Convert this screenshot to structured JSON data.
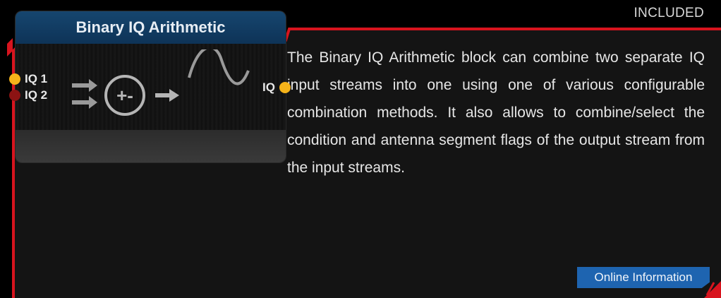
{
  "status_badge": "INCLUDED",
  "block": {
    "title": "Binary IQ Arithmetic",
    "input_ports": [
      {
        "label": "IQ 1",
        "color": "#f5b31a"
      },
      {
        "label": "IQ 2",
        "color": "#8c1313"
      }
    ],
    "output_port": {
      "label": "IQ",
      "color": "#f5b31a"
    },
    "operator_symbol": "+-",
    "icons": [
      "double-arrow-icon",
      "plus-minus-circle-icon",
      "arrow-right-icon",
      "sine-wave-icon"
    ]
  },
  "description": "The Binary IQ Arithmetic block can combine two separate IQ input streams into one using one of various configurable combination methods. It also allows to combine/select the condition and antenna segment flags of the output stream from the input streams.",
  "online_button": "Online Information",
  "colors": {
    "frame_red": "#d8141e",
    "panel_bg": "#141414",
    "title_blue": "#16466f",
    "button_blue": "#1e64b0",
    "port_yellow": "#f5b31a",
    "port_red": "#8c1313"
  }
}
